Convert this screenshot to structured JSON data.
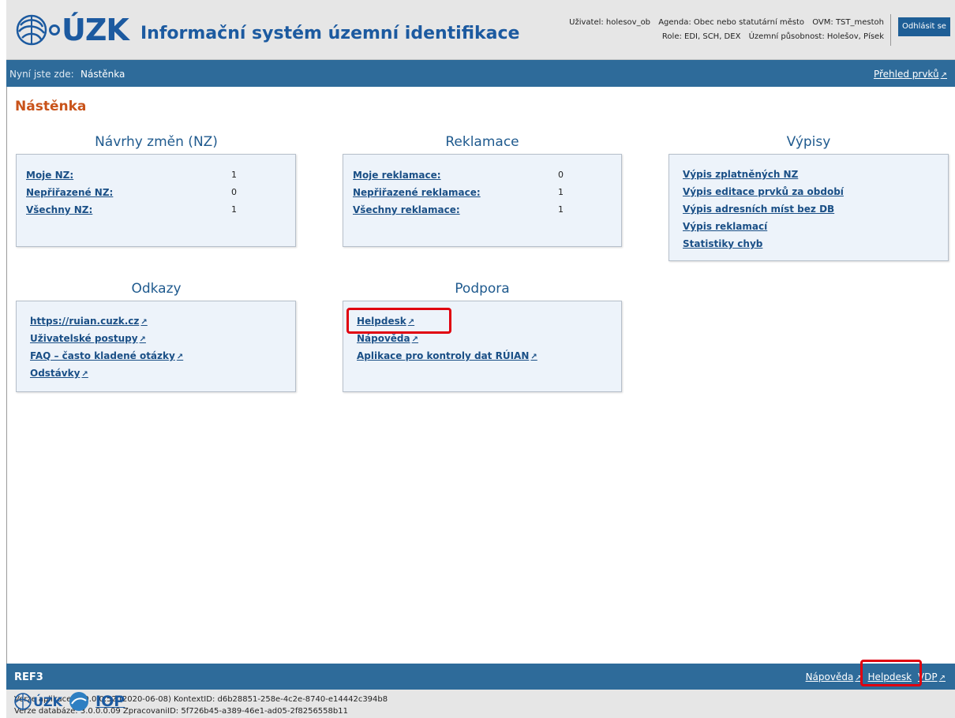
{
  "header": {
    "logo_text": "ÚZK",
    "app_title": "Informační systém územní identifikace",
    "user": "Uživatel: holesov_ob",
    "agenda": "Agenda: Obec nebo statutární město",
    "ovm": "OVM: TST_mestoh",
    "role": "Role: EDI, SCH, DEX",
    "scope": "Územní působnost: Holešov, Písek",
    "logout_label": "Odhlásit se"
  },
  "breadcrumb": {
    "prefix": "Nyní jste zde:",
    "current": "Nástěnka",
    "right_link": "Přehled prvků"
  },
  "page_title": "Nástěnka",
  "sections": {
    "nz": {
      "title": "Návrhy změn (NZ)",
      "rows": [
        {
          "label": "Moje NZ:",
          "value": "1"
        },
        {
          "label": "Nepřiřazené NZ:",
          "value": "0"
        },
        {
          "label": "Všechny NZ:",
          "value": "1"
        }
      ]
    },
    "reklamace": {
      "title": "Reklamace",
      "rows": [
        {
          "label": "Moje reklamace:",
          "value": "0"
        },
        {
          "label": "Nepřiřazené reklamace:",
          "value": "1"
        },
        {
          "label": "Všechny reklamace:",
          "value": "1"
        }
      ]
    },
    "vypisy": {
      "title": "Výpisy",
      "links": [
        "Výpis zplatněných NZ",
        "Výpis editace prvků za období",
        "Výpis adresních míst bez DB",
        "Výpis reklamací",
        "Statistiky chyb"
      ]
    },
    "odkazy": {
      "title": "Odkazy",
      "links": [
        "https://ruian.cuzk.cz",
        "Uživatelské postupy",
        "FAQ – často kladené otázky",
        "Odstávky"
      ]
    },
    "podpora": {
      "title": "Podpora",
      "links": [
        "Helpdesk",
        "Nápověda",
        "Aplikace pro kontroly dat RÚIAN"
      ]
    }
  },
  "footer": {
    "env": "REF3",
    "links": [
      "Nápověda",
      "Helpdesk",
      "VDP"
    ],
    "version_line": "Verze aplikace: 3.0.0.0.52 (2020-06-08) KontextID: d6b28851-258e-4c2e-8740-e14442c394b8",
    "db_line": "Verze databáze: 3.0.0.0.09 ZpracovaniID: 5f726b45-a389-46e1-ad05-2f8256558b11",
    "logo_text": "ÚZK",
    "iop_text": "IOP"
  },
  "colors": {
    "header_bg": "#e6e6e6",
    "nav_bar": "#2e6b9a",
    "title_orange": "#c9531a",
    "link_blue": "#1a4f86",
    "box_bg": "#edf3fa",
    "highlight_red": "#e0000f"
  },
  "icons": {
    "external_link": "external-link-icon",
    "logo_emblem": "cuzk-emblem-icon"
  }
}
